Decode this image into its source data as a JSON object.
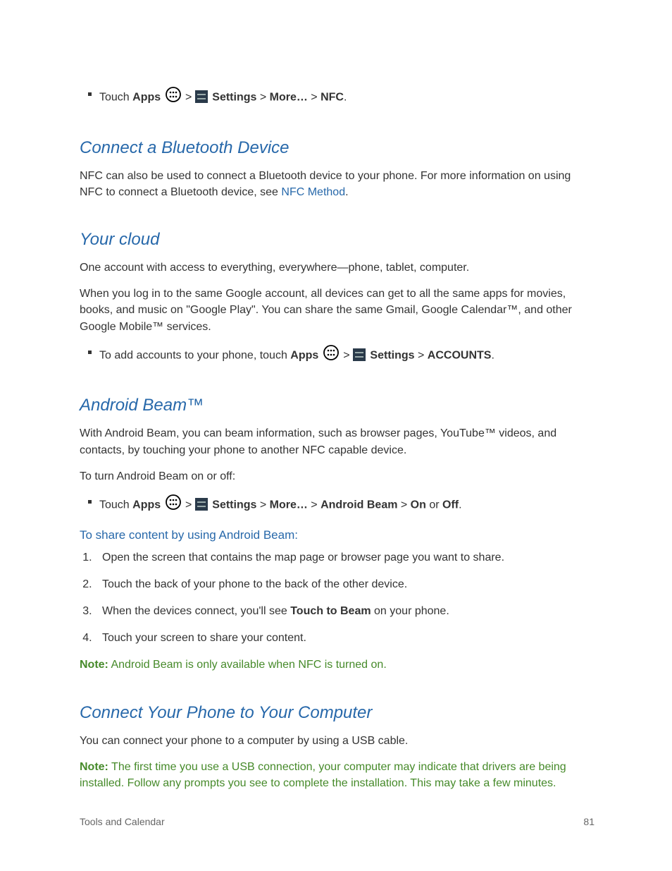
{
  "nav1": {
    "touch": "Touch ",
    "apps": "Apps",
    "sep1": " > ",
    "settings": " Settings",
    "sep2": " > ",
    "more": "More…",
    "sep3": " > ",
    "nfc": "NFC",
    "end": "."
  },
  "section1": {
    "heading": "Connect a Bluetooth Device",
    "p1a": "NFC can also be used to connect a Bluetooth device to your phone. For more information on using NFC to connect a Bluetooth device, see ",
    "link": "NFC Method",
    "p1b": "."
  },
  "section2": {
    "heading": "Your cloud",
    "p1": "One account with access to everything, everywhere—phone, tablet, computer.",
    "p2": "When you log in to the same Google account, all devices can get to all the same apps for movies, books, and music on \"Google Play\". You can share the same Gmail, Google Calendar™, and other Google Mobile™ services.",
    "bullet": {
      "pre": "To add accounts to your phone, touch ",
      "apps": "Apps",
      "sep1": " > ",
      "settings": " Settings",
      "sep2": " > ",
      "accounts": "ACCOUNTS",
      "end": "."
    }
  },
  "section3": {
    "heading": "Android Beam™",
    "p1": "With Android Beam, you can beam information, such as browser pages, YouTube™ videos, and contacts, by touching your phone to another NFC capable device.",
    "p2": "To turn Android Beam on or off:",
    "bullet": {
      "touch": "Touch ",
      "apps": "Apps",
      "sep1": " > ",
      "settings": " Settings",
      "sep2": " > ",
      "more": "More…",
      "sep3": " > ",
      "ab": "Android Beam",
      "sep4": " > ",
      "on": "On",
      "or": " or ",
      "off": "Off",
      "end": "."
    },
    "sub": "To share content by using Android Beam:",
    "steps": {
      "s1": "Open the screen that contains the map page or browser page you want to share.",
      "s2": "Touch the back of your phone to the back of the other device.",
      "s3a": "When the devices connect, you'll see ",
      "s3b": "Touch to Beam",
      "s3c": " on your phone.",
      "s4": "Touch your screen to share your content."
    },
    "note_label": "Note:",
    "note_text": " Android Beam is only available when NFC is turned on."
  },
  "section4": {
    "heading": "Connect Your Phone to Your Computer",
    "p1": "You can connect your phone to a computer by using a USB cable.",
    "note_label": "Note:",
    "note_text": " The first time you use a USB connection, your computer may indicate that drivers are being installed. Follow any prompts you see to complete the installation. This may take a few minutes."
  },
  "footer": {
    "left": "Tools and Calendar",
    "right": "81"
  }
}
